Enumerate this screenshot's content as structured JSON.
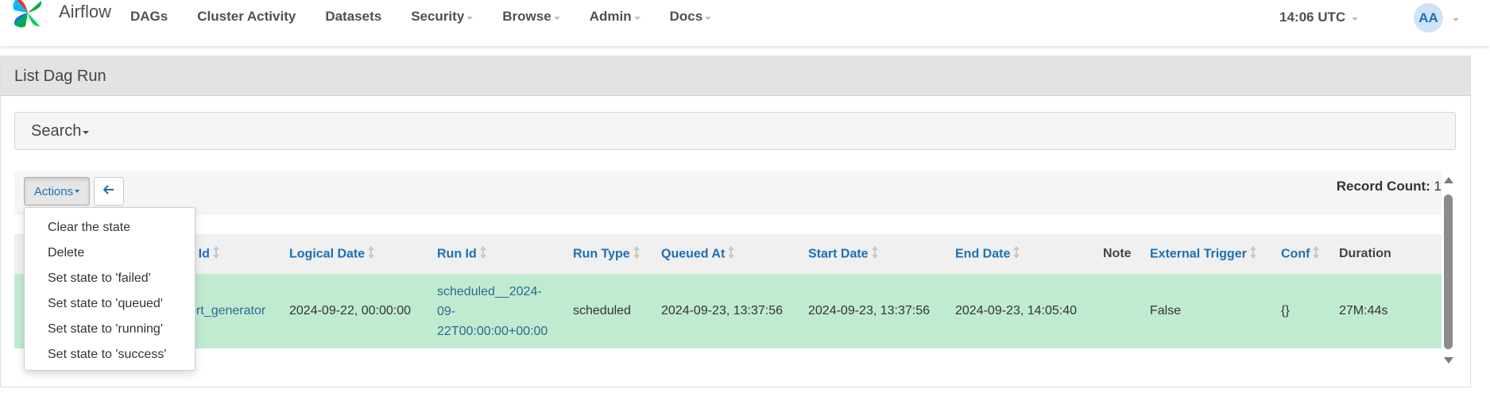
{
  "navbar": {
    "brand": "Airflow",
    "items": [
      {
        "label": "DAGs",
        "has_caret": false
      },
      {
        "label": "Cluster Activity",
        "has_caret": false
      },
      {
        "label": "Datasets",
        "has_caret": false
      },
      {
        "label": "Security",
        "has_caret": true
      },
      {
        "label": "Browse",
        "has_caret": true
      },
      {
        "label": "Admin",
        "has_caret": true
      },
      {
        "label": "Docs",
        "has_caret": true
      }
    ],
    "clock": "14:06 UTC",
    "avatar": "AA"
  },
  "panel": {
    "title": "List Dag Run",
    "search_label": "Search",
    "actions_label": "Actions",
    "record_count_label": "Record Count:",
    "record_count": "1"
  },
  "dropdown": {
    "items": [
      "Clear the state",
      "Delete",
      "Set state to 'failed'",
      "Set state to 'queued'",
      "Set state to 'running'",
      "Set state to 'success'"
    ]
  },
  "table": {
    "columns": [
      {
        "label": "",
        "sortable": false
      },
      {
        "label": "Dag Id",
        "sortable": true
      },
      {
        "label": "Logical Date",
        "sortable": true
      },
      {
        "label": "Run Id",
        "sortable": true
      },
      {
        "label": "Run Type",
        "sortable": true
      },
      {
        "label": "Queued At",
        "sortable": true
      },
      {
        "label": "Start Date",
        "sortable": true
      },
      {
        "label": "End Date",
        "sortable": true
      },
      {
        "label": "Note",
        "sortable": false
      },
      {
        "label": "External Trigger",
        "sortable": true
      },
      {
        "label": "Conf",
        "sortable": true
      },
      {
        "label": "Duration",
        "sortable": false
      }
    ],
    "rows": [
      {
        "dag_id": "report_generator",
        "logical_date": "2024-09-22, 00:00:00",
        "run_id_lines": [
          "scheduled__2024-",
          "09-",
          "22T00:00:00+00:00"
        ],
        "run_type": "scheduled",
        "queued_at": "2024-09-23, 13:37:56",
        "start_date": "2024-09-23, 13:37:56",
        "end_date": "2024-09-23, 14:05:40",
        "note": "",
        "external_trigger": "False",
        "conf": "{}",
        "duration": "27M:44s",
        "state_color": "#c1ebd1"
      }
    ]
  },
  "colors": {
    "link": "#1b6fb5",
    "row_success": "#c1ebd1",
    "heading_bg": "#e3e3e3"
  }
}
